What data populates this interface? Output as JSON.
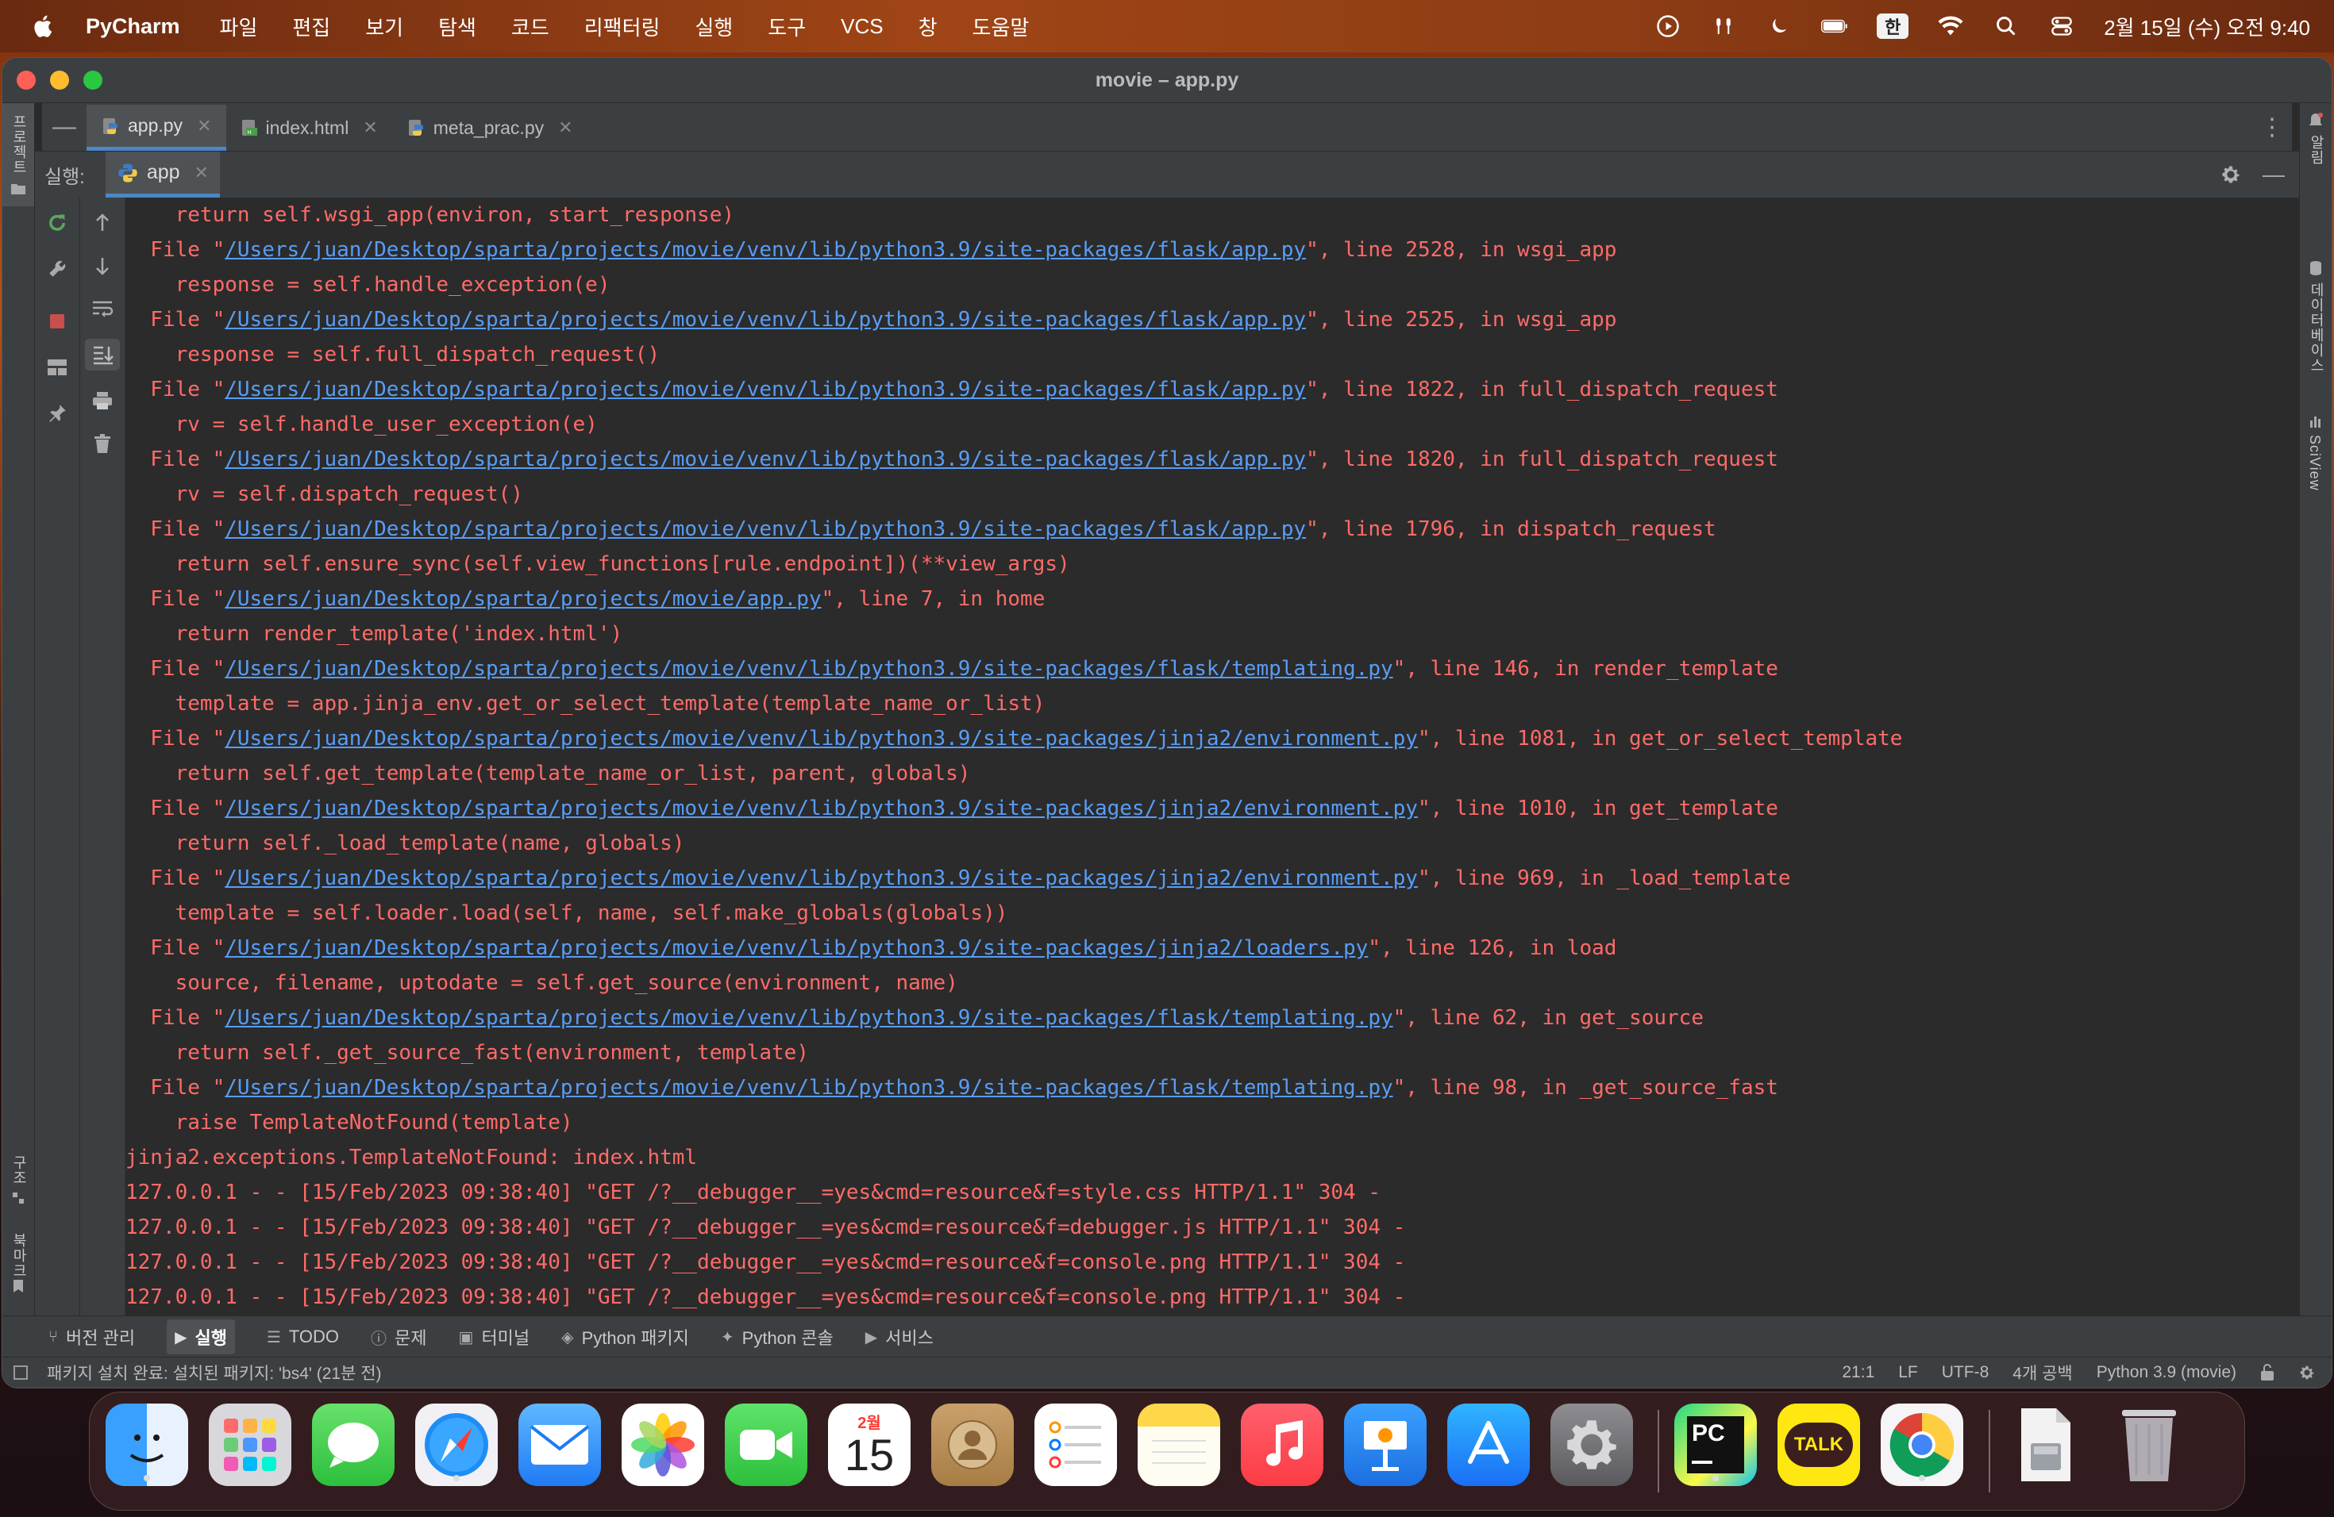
{
  "menubar": {
    "app_name": "PyCharm",
    "items": [
      "파일",
      "편집",
      "보기",
      "탐색",
      "코드",
      "리팩터링",
      "실행",
      "도구",
      "VCS",
      "창",
      "도움말"
    ],
    "ime": "한",
    "clock": "2월 15일 (수) 오전 9:40"
  },
  "window": {
    "title": "movie – app.py"
  },
  "editor_tabs": [
    {
      "label": "app.py",
      "active": true
    },
    {
      "label": "index.html",
      "active": false
    },
    {
      "label": "meta_prac.py",
      "active": false
    }
  ],
  "run_panel": {
    "label": "실행:",
    "config": "app"
  },
  "left_stripe": {
    "project": "프로젝트",
    "structure": "구조",
    "bookmarks": "북마크"
  },
  "right_stripe": {
    "notifications": "알림",
    "database": "데이터베이스",
    "sciview": "SciView"
  },
  "console": [
    {
      "type": "code",
      "text": "    return self.wsgi_app(environ, start_response)"
    },
    {
      "type": "file",
      "pre": "  File \"",
      "link": "/Users/juan/Desktop/sparta/projects/movie/venv/lib/python3.9/site-packages/flask/app.py",
      "post": "\", line 2528, in wsgi_app"
    },
    {
      "type": "code",
      "text": "    response = self.handle_exception(e)"
    },
    {
      "type": "file",
      "pre": "  File \"",
      "link": "/Users/juan/Desktop/sparta/projects/movie/venv/lib/python3.9/site-packages/flask/app.py",
      "post": "\", line 2525, in wsgi_app"
    },
    {
      "type": "code",
      "text": "    response = self.full_dispatch_request()"
    },
    {
      "type": "file",
      "pre": "  File \"",
      "link": "/Users/juan/Desktop/sparta/projects/movie/venv/lib/python3.9/site-packages/flask/app.py",
      "post": "\", line 1822, in full_dispatch_request"
    },
    {
      "type": "code",
      "text": "    rv = self.handle_user_exception(e)"
    },
    {
      "type": "file",
      "pre": "  File \"",
      "link": "/Users/juan/Desktop/sparta/projects/movie/venv/lib/python3.9/site-packages/flask/app.py",
      "post": "\", line 1820, in full_dispatch_request"
    },
    {
      "type": "code",
      "text": "    rv = self.dispatch_request()"
    },
    {
      "type": "file",
      "pre": "  File \"",
      "link": "/Users/juan/Desktop/sparta/projects/movie/venv/lib/python3.9/site-packages/flask/app.py",
      "post": "\", line 1796, in dispatch_request"
    },
    {
      "type": "code",
      "text": "    return self.ensure_sync(self.view_functions[rule.endpoint])(**view_args)"
    },
    {
      "type": "file",
      "pre": "  File \"",
      "link": "/Users/juan/Desktop/sparta/projects/movie/app.py",
      "post": "\", line 7, in home"
    },
    {
      "type": "code",
      "text": "    return render_template('index.html')"
    },
    {
      "type": "file",
      "pre": "  File \"",
      "link": "/Users/juan/Desktop/sparta/projects/movie/venv/lib/python3.9/site-packages/flask/templating.py",
      "post": "\", line 146, in render_template"
    },
    {
      "type": "code",
      "text": "    template = app.jinja_env.get_or_select_template(template_name_or_list)"
    },
    {
      "type": "file",
      "pre": "  File \"",
      "link": "/Users/juan/Desktop/sparta/projects/movie/venv/lib/python3.9/site-packages/jinja2/environment.py",
      "post": "\", line 1081, in get_or_select_template"
    },
    {
      "type": "code",
      "text": "    return self.get_template(template_name_or_list, parent, globals)"
    },
    {
      "type": "file",
      "pre": "  File \"",
      "link": "/Users/juan/Desktop/sparta/projects/movie/venv/lib/python3.9/site-packages/jinja2/environment.py",
      "post": "\", line 1010, in get_template"
    },
    {
      "type": "code",
      "text": "    return self._load_template(name, globals)"
    },
    {
      "type": "file",
      "pre": "  File \"",
      "link": "/Users/juan/Desktop/sparta/projects/movie/venv/lib/python3.9/site-packages/jinja2/environment.py",
      "post": "\", line 969, in _load_template"
    },
    {
      "type": "code",
      "text": "    template = self.loader.load(self, name, self.make_globals(globals))"
    },
    {
      "type": "file",
      "pre": "  File \"",
      "link": "/Users/juan/Desktop/sparta/projects/movie/venv/lib/python3.9/site-packages/jinja2/loaders.py",
      "post": "\", line 126, in load"
    },
    {
      "type": "code",
      "text": "    source, filename, uptodate = self.get_source(environment, name)"
    },
    {
      "type": "file",
      "pre": "  File \"",
      "link": "/Users/juan/Desktop/sparta/projects/movie/venv/lib/python3.9/site-packages/flask/templating.py",
      "post": "\", line 62, in get_source"
    },
    {
      "type": "code",
      "text": "    return self._get_source_fast(environment, template)"
    },
    {
      "type": "file",
      "pre": "  File \"",
      "link": "/Users/juan/Desktop/sparta/projects/movie/venv/lib/python3.9/site-packages/flask/templating.py",
      "post": "\", line 98, in _get_source_fast"
    },
    {
      "type": "code",
      "text": "    raise TemplateNotFound(template)"
    },
    {
      "type": "code",
      "text": "jinja2.exceptions.TemplateNotFound: index.html"
    },
    {
      "type": "log",
      "pre": "127.0.0.1 - - [15/Feb/2023 09:38:40] ",
      "req": "\"GET /?__debugger__=yes&cmd=resource&f=style.css HTTP/1.1\"",
      "post": " 304 -"
    },
    {
      "type": "log",
      "pre": "127.0.0.1 - - [15/Feb/2023 09:38:40] ",
      "req": "\"GET /?__debugger__=yes&cmd=resource&f=debugger.js HTTP/1.1\"",
      "post": " 304 -"
    },
    {
      "type": "log",
      "pre": "127.0.0.1 - - [15/Feb/2023 09:38:40] ",
      "req": "\"GET /?__debugger__=yes&cmd=resource&f=console.png HTTP/1.1\"",
      "post": " 304 -"
    },
    {
      "type": "log",
      "pre": "127.0.0.1 - - [15/Feb/2023 09:38:40] ",
      "req": "\"GET /?__debugger__=yes&cmd=resource&f=console.png HTTP/1.1\"",
      "post": " 304 -"
    }
  ],
  "bottom_tabs": [
    {
      "icon": "branch-icon",
      "label": "버전 관리",
      "active": false
    },
    {
      "icon": "run-icon",
      "label": "실행",
      "active": true
    },
    {
      "icon": "list-icon",
      "label": "TODO",
      "active": false
    },
    {
      "icon": "problems-icon",
      "label": "문제",
      "active": false
    },
    {
      "icon": "terminal-icon",
      "label": "터미널",
      "active": false
    },
    {
      "icon": "packages-icon",
      "label": "Python 패키지",
      "active": false
    },
    {
      "icon": "python-icon",
      "label": "Python 콘솔",
      "active": false
    },
    {
      "icon": "services-icon",
      "label": "서비스",
      "active": false
    }
  ],
  "status": {
    "message": "패키지 설치 완료: 설치된 패키지: 'bs4' (21분 전)",
    "position": "21:1",
    "line_sep": "LF",
    "encoding": "UTF-8",
    "indent": "4개 공백",
    "interpreter": "Python 3.9 (movie)"
  },
  "dock": {
    "calendar_month": "2월",
    "calendar_day": "15",
    "kakao_label": "TALK",
    "pycharm_label": "PC",
    "apps": [
      "finder",
      "launchpad",
      "messages",
      "safari",
      "mail",
      "photos",
      "facetime",
      "calendar",
      "contacts",
      "reminders",
      "notes",
      "music",
      "keynote",
      "app-store",
      "system-settings",
      "pycharm",
      "kakaotalk",
      "chrome",
      "downloads",
      "trash"
    ]
  },
  "colors": {
    "accent": "#4a88c7",
    "error_text": "#ff6b68",
    "link": "#589df6",
    "console_bg": "#2b2b2b"
  }
}
